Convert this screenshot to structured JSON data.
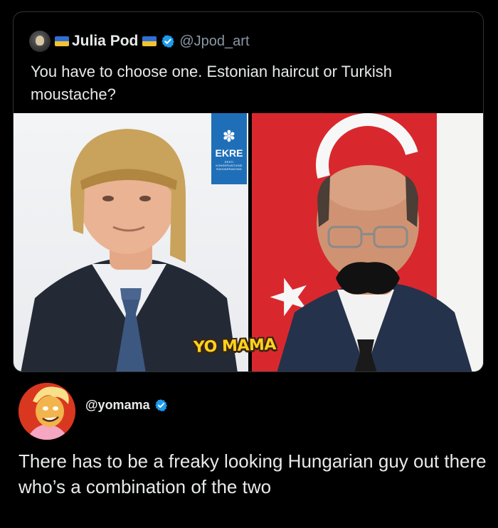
{
  "quoted_post": {
    "author_name": "Julia Pod",
    "handle": "@Jpod_art",
    "text": "You have to choose one. Estonian haircut or Turkish moustache?",
    "media": {
      "left_photo": {
        "badge_text": "EKRE",
        "badge_subtext": "EESTI KONSERVATIIVNE RAHVAERAKOND"
      },
      "watermark": "YO MAMA"
    }
  },
  "reply": {
    "handle": "@yomama",
    "text": "There has to be a freaky looking Hungarian guy out there  who’s a combination of the two"
  },
  "icons": {
    "verified": "verified-badge-icon",
    "flag": "ukraine-flag-icon"
  },
  "colors": {
    "background": "#000000",
    "text_primary": "#e7e9ea",
    "text_secondary": "#8b98a5",
    "verified_blue": "#1d9bf0",
    "card_border": "#2f3336"
  }
}
